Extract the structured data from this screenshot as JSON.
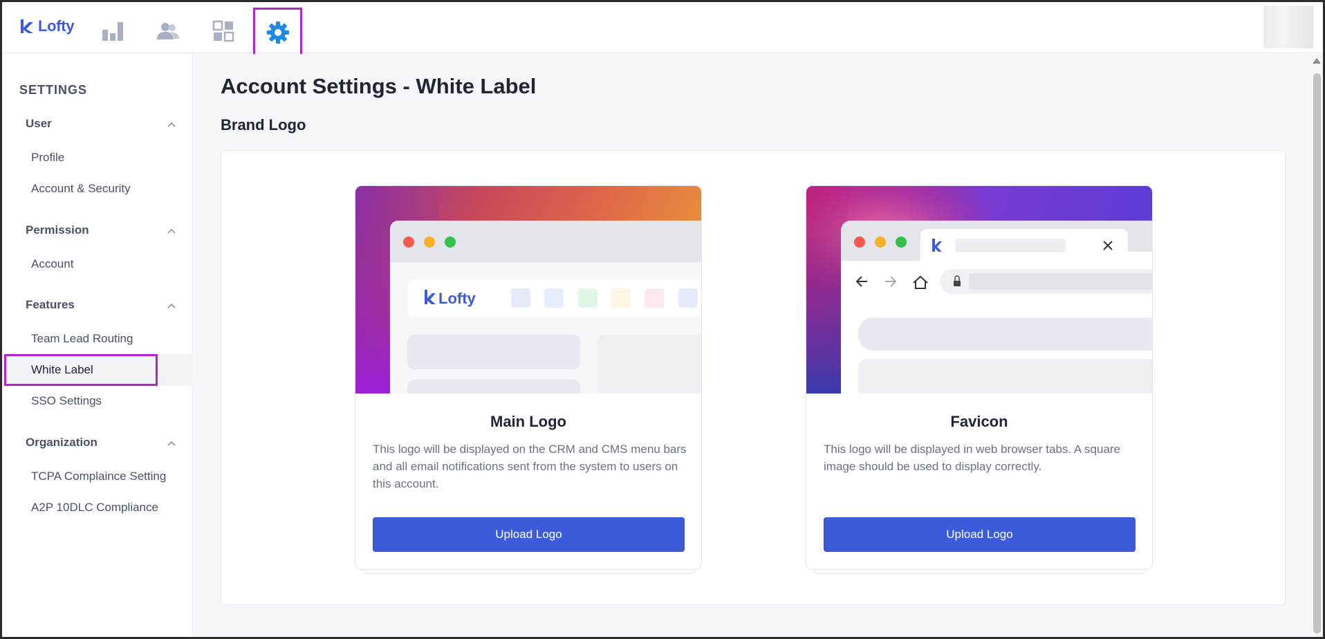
{
  "app": {
    "brand_name": "Lofty",
    "brand_color": "#3b5bdb",
    "highlight_color": "#b620d6"
  },
  "topnav": {
    "items": [
      {
        "icon": "bar-chart-icon",
        "active": false
      },
      {
        "icon": "people-icon",
        "active": false
      },
      {
        "icon": "dashboard-grid-icon",
        "active": false
      },
      {
        "icon": "gear-icon",
        "active": true
      }
    ]
  },
  "sidebar": {
    "title": "SETTINGS",
    "groups": [
      {
        "label": "User",
        "items": [
          "Profile",
          "Account & Security"
        ]
      },
      {
        "label": "Permission",
        "items": [
          "Account"
        ]
      },
      {
        "label": "Features",
        "items": [
          "Team Lead Routing",
          "White Label",
          "SSO Settings"
        ]
      },
      {
        "label": "Organization",
        "items": [
          "TCPA Complaince Setting",
          "A2P 10DLC Compliance"
        ]
      }
    ],
    "active_item": "White Label"
  },
  "main": {
    "page_title": "Account Settings - White Label",
    "section_title": "Brand Logo",
    "cards": [
      {
        "title": "Main Logo",
        "description": "This logo will be displayed on the CRM and CMS menu bars and all email notifications sent from the system to users on this account.",
        "button_label": "Upload Logo",
        "preview_brand": "Lofty"
      },
      {
        "title": "Favicon",
        "description": "This logo will be displayed in web browser tabs. A square image should be used to display correctly.",
        "button_label": "Upload Logo"
      }
    ]
  }
}
